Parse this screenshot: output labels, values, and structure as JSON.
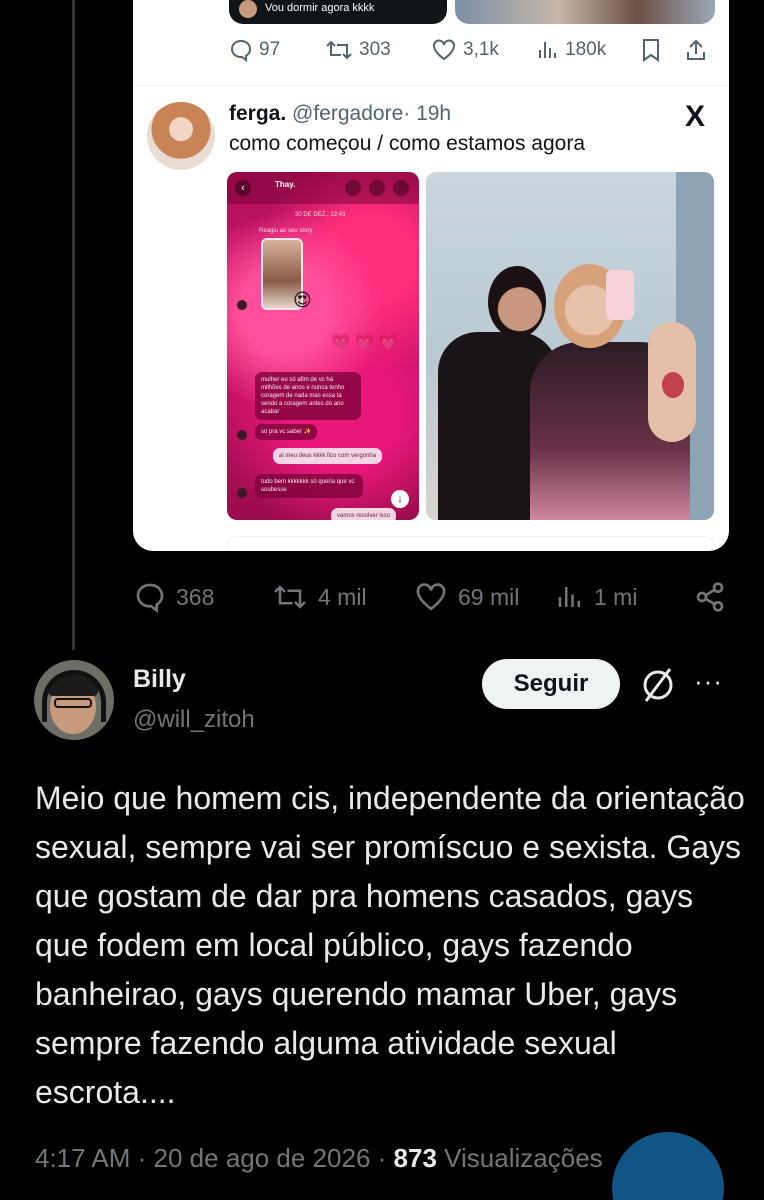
{
  "quoted_prev": {
    "media_caption": "Vou dormir agora kkkk",
    "replies": "97",
    "reposts": "303",
    "likes": "3,1k",
    "views": "180k"
  },
  "quoted_post": {
    "name": "ferga.",
    "handle": "@fergadore",
    "time": "· 19h",
    "text": "como começou / como estamos agora",
    "platform_logo": "X",
    "dm": {
      "contact": "Thay.",
      "date": "30 DE DEZ., 22:43",
      "story_label": "Reagiu ao seu story",
      "emoji": "😍",
      "hearts": "💗💗💗",
      "msg1": "mulher eu só afim de vc há milhões de anos e nunca tenho coragem de nada mas essa ta sendo a coragem antes do ano acabar",
      "msg2": "só pra vc saber ✨",
      "msg3": "ai meu deus kkkk fico com vergonha",
      "msg4": "tudo bem kkkkkkk só queria que vc soubesse",
      "msg5": "vamos resolver isso"
    }
  },
  "post_actions": {
    "replies": "368",
    "reposts": "4 mil",
    "likes": "69 mil",
    "views": "1 mi"
  },
  "reply": {
    "name": "Billy",
    "handle": "@will_zitoh",
    "follow_label": "Seguir",
    "more": "···",
    "text": "Meio que homem cis, independente da orientação sexual, sempre vai ser promíscuo e sexista. Gays que gostam de dar pra homens casados, gays que fodem em local público, gays fazendo banheirao, gays querendo mamar Uber, gays sempre fazendo alguma atividade sexual escrota....",
    "time": "4:17 AM",
    "date": "20 de ago de 2026",
    "views_count": "873",
    "views_label": "Visualizações"
  },
  "icons": [
    "reply-icon",
    "repost-icon",
    "like-icon",
    "views-icon",
    "bookmark-icon",
    "share-icon",
    "x-logo",
    "grok-icon",
    "more-icon"
  ],
  "colors": {
    "background": "#000000",
    "text": "#e7e9ea",
    "muted": "#71767b",
    "accent": "#1d9bf0",
    "card": "#ffffff"
  }
}
